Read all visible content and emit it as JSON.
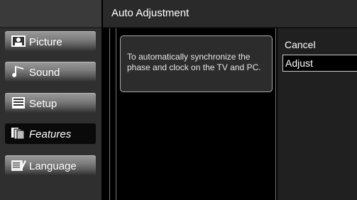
{
  "header": {
    "title": "Auto Adjustment"
  },
  "sidebar": {
    "items": [
      {
        "label": "Picture",
        "icon": "picture-icon",
        "active": false
      },
      {
        "label": "Sound",
        "icon": "music-note-icon",
        "active": false
      },
      {
        "label": "Setup",
        "icon": "setup-list-icon",
        "active": false
      },
      {
        "label": "Features",
        "icon": "features-pages-icon",
        "active": true
      },
      {
        "label": "Language",
        "icon": "language-icon",
        "active": false
      }
    ]
  },
  "message": "To automatically synchronize the phase and clock on the TV and PC.",
  "options": [
    {
      "label": "Cancel",
      "selected": false
    },
    {
      "label": "Adjust",
      "selected": true
    }
  ],
  "colors": {
    "highlight": "#000000",
    "menu_gradient_top": "#9a9a9a",
    "background": "#000000"
  }
}
